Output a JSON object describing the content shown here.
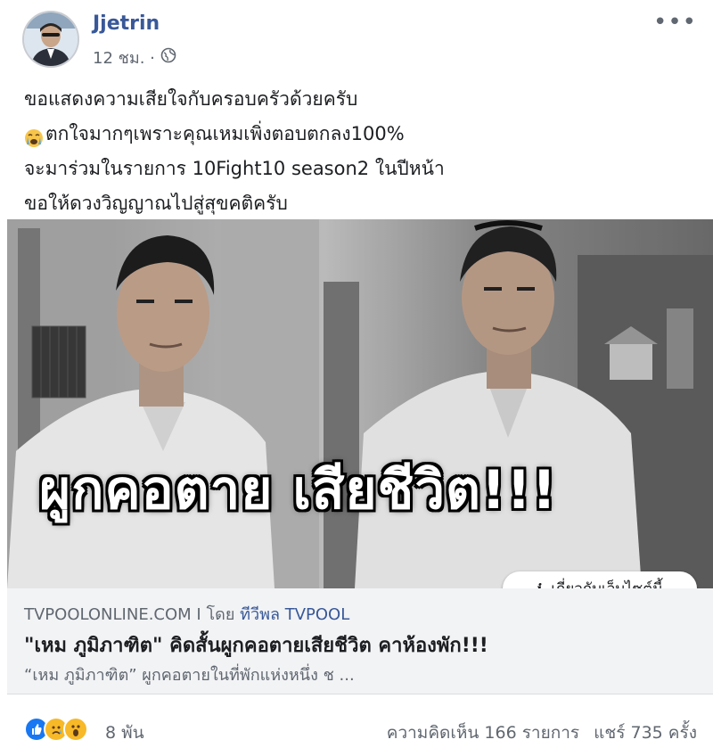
{
  "post": {
    "author": "Jjetrin",
    "time": "12 ชม. ·",
    "lines": [
      "ขอแสดงความเสียใจกับครอบครัวด้วยครับ",
      "ตกใจมากๆเพราะคุณเหมเพิ่งตอบตกลง100%",
      "จะมาร่วมในรายการ 10Fight10 season2 ในปีหน้า",
      "ขอให้ดวงวิญญาณไปสู่สุขคติครับ"
    ]
  },
  "image": {
    "headline": "ผูกคอตาย เสียชีวิต!!!",
    "about_button": "เกี่ยวกับเว็บไซต์นี้"
  },
  "link": {
    "domain": "TVPOOLONLINE.COM",
    "separator": "I",
    "by_label": "โดย",
    "by_name": "ทีวีพล TVPOOL",
    "title": "\"เหม ภูมิภาฑิต\" คิดสั้นผูกคอตายเสียชีวิต คาห้องพัก!!!",
    "description": "“เหม ภูมิภาฑิต” ผูกคอตายในที่พักแห่งหนึ่ง ช ..."
  },
  "footer": {
    "reaction_count": "8 พัน",
    "comments": "ความคิดเห็น 166 รายการ",
    "shares": "แชร์ 735 ครั้ง"
  },
  "colors": {
    "link_blue": "#385898",
    "like_blue": "#1877f2",
    "reaction_yellow": "#f7b928"
  },
  "icons": [
    "more-options-icon",
    "globe-icon",
    "crying-emoji-icon",
    "info-icon",
    "like-icon",
    "sad-icon",
    "wow-icon"
  ]
}
